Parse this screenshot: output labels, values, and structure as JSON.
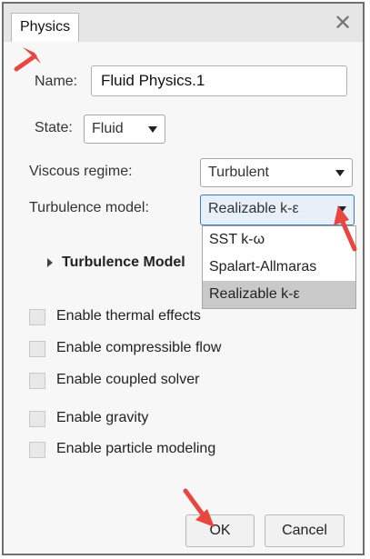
{
  "dialog": {
    "tab_label": "Physics",
    "close_glyph": "✕"
  },
  "form": {
    "name_label": "Name:",
    "name_value": "Fluid Physics.1",
    "state_label": "State:",
    "state_value": "Fluid",
    "viscous_label": "Viscous regime:",
    "viscous_value": "Turbulent",
    "turbulence_label": "Turbulence model:",
    "turbulence_value": "Realizable k-ε",
    "turbulence_options": [
      "SST k-ω",
      "Spalart-Allmaras",
      "Realizable k-ε"
    ],
    "section_label": "Turbulence Model"
  },
  "checkboxes": [
    {
      "label": "Enable thermal effects",
      "checked": false
    },
    {
      "label": "Enable compressible flow",
      "checked": false
    },
    {
      "label": "Enable coupled solver",
      "checked": false
    },
    {
      "label": "Enable gravity",
      "checked": false
    },
    {
      "label": "Enable particle modeling",
      "checked": false
    }
  ],
  "buttons": {
    "ok_label": "OK",
    "cancel_label": "Cancel"
  },
  "colors": {
    "annotation_arrow": "#e8473f",
    "active_select_border": "#3e7ab8"
  }
}
